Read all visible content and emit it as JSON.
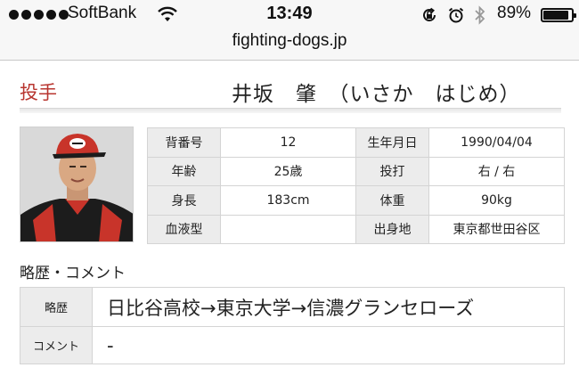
{
  "status_bar": {
    "carrier": "SoftBank",
    "time": "13:49",
    "battery_percent": "89%",
    "battery_level": 0.89,
    "icons": [
      "signal-dots-icon",
      "wifi-icon",
      "rotation-lock-icon",
      "alarm-icon",
      "bluetooth-icon",
      "battery-icon"
    ]
  },
  "browser": {
    "url": "fighting-dogs.jp"
  },
  "player": {
    "position": "投手",
    "name": "井坂　肇　（いさか　はじめ）"
  },
  "profile": {
    "rows": [
      {
        "k1": "背番号",
        "v1": "12",
        "k2": "生年月日",
        "v2": "1990/04/04"
      },
      {
        "k1": "年齢",
        "v1": "25歳",
        "k2": "投打",
        "v2": "右 / 右"
      },
      {
        "k1": "身長",
        "v1": "183cm",
        "k2": "体重",
        "v2": "90kg"
      },
      {
        "k1": "血液型",
        "v1": "",
        "k2": "出身地",
        "v2": "東京都世田谷区"
      }
    ]
  },
  "comments": {
    "title": "略歴・コメント",
    "rows": [
      {
        "k": "略歴",
        "v": "日比谷高校→東京大学→信濃グランセローズ"
      },
      {
        "k": "コメント",
        "v": "-"
      }
    ]
  },
  "colors": {
    "accent": "#b8352f",
    "label_bg": "#ececec",
    "border": "#d4d4d4"
  }
}
